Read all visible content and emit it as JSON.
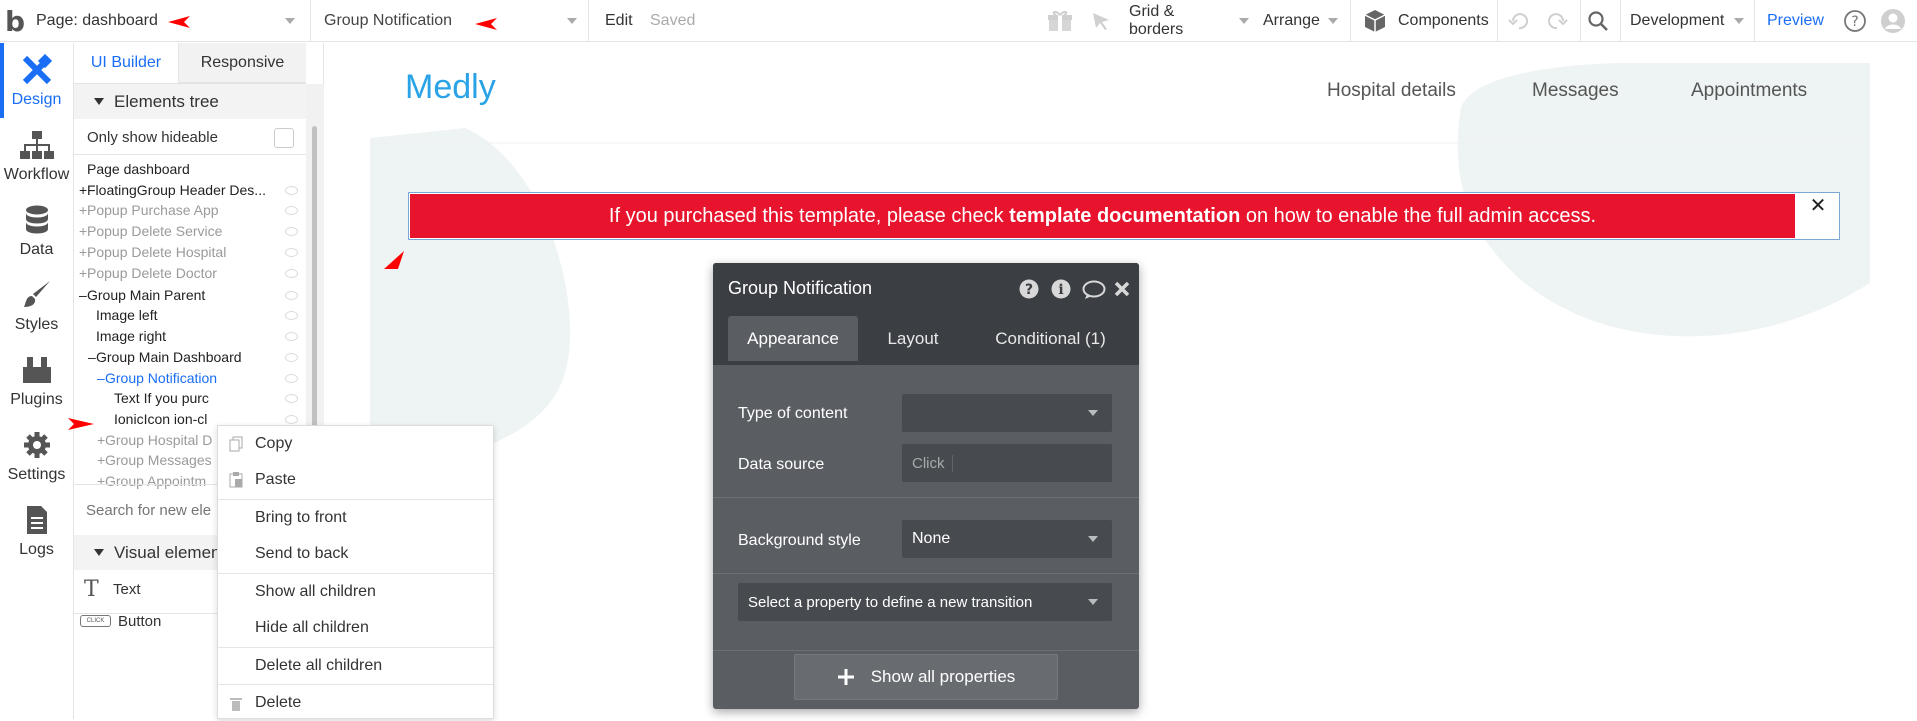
{
  "topbar": {
    "logo": "b",
    "page_selector": "Page: dashboard",
    "element_selector": "Group Notification",
    "edit": "Edit",
    "saved": "Saved",
    "grid_borders": "Grid & borders",
    "arrange": "Arrange",
    "components": "Components",
    "environment": "Development",
    "preview": "Preview",
    "help_icon": "question-circle-icon"
  },
  "rail": {
    "items": [
      {
        "label": "Design",
        "icon": "design-icon",
        "active": true
      },
      {
        "label": "Workflow",
        "icon": "workflow-icon"
      },
      {
        "label": "Data",
        "icon": "database-icon"
      },
      {
        "label": "Styles",
        "icon": "brush-icon"
      },
      {
        "label": "Plugins",
        "icon": "plugins-icon"
      },
      {
        "label": "Settings",
        "icon": "gear-icon"
      },
      {
        "label": "Logs",
        "icon": "document-icon"
      }
    ]
  },
  "panel": {
    "tabs": [
      "UI Builder",
      "Responsive"
    ],
    "elements_tree_label": "Elements tree",
    "only_show_hideable": "Only show hideable",
    "tree": [
      {
        "prefix": "",
        "label": "Page dashboard",
        "state": "normal",
        "indent": 0
      },
      {
        "prefix": "+",
        "label": "FloatingGroup Header Des...",
        "state": "normal",
        "indent": 0
      },
      {
        "prefix": "+",
        "label": "Popup Purchase App",
        "state": "dim",
        "indent": 0
      },
      {
        "prefix": "+",
        "label": "Popup Delete Service",
        "state": "dim",
        "indent": 0
      },
      {
        "prefix": "+",
        "label": "Popup Delete Hospital",
        "state": "dim",
        "indent": 0
      },
      {
        "prefix": "+",
        "label": "Popup Delete Doctor",
        "state": "dim",
        "indent": 0
      },
      {
        "prefix": "–",
        "label": "Group Main Parent",
        "state": "normal",
        "indent": 0
      },
      {
        "prefix": "",
        "label": "Image left",
        "state": "normal",
        "indent": 1
      },
      {
        "prefix": "",
        "label": "Image right",
        "state": "normal",
        "indent": 1
      },
      {
        "prefix": "–",
        "label": "Group Main Dashboard",
        "state": "normal",
        "indent": 1
      },
      {
        "prefix": "–",
        "label": "Group Notification",
        "state": "sel",
        "indent": 2
      },
      {
        "prefix": "",
        "label": "Text If you purc",
        "state": "normal",
        "indent": 3
      },
      {
        "prefix": "",
        "label": "IonicIcon ion-cl",
        "state": "normal",
        "indent": 3
      },
      {
        "prefix": "+",
        "label": "Group Hospital D",
        "state": "dim",
        "indent": 2
      },
      {
        "prefix": "+",
        "label": "Group Messages",
        "state": "dim",
        "indent": 2
      },
      {
        "prefix": "+",
        "label": "Group Appointm",
        "state": "dim",
        "indent": 2
      }
    ],
    "search_placeholder": "Search for new ele",
    "visual_elements_label": "Visual elemen",
    "visual_items": [
      {
        "label": "Text",
        "icon": "text-T-icon"
      },
      {
        "label": "Button",
        "icon": "button-click-icon",
        "icon_text": "CLICK"
      }
    ]
  },
  "context_menu": {
    "items": [
      "Copy",
      "Paste",
      "Bring to front",
      "Send to back",
      "Show all children",
      "Hide all children",
      "Delete all children",
      "Delete"
    ]
  },
  "canvas": {
    "logo": "Medly",
    "nav": [
      "Hospital details",
      "Messages",
      "Appointments"
    ],
    "banner_pre": "If you purchased this template, please check ",
    "banner_bold": "template documentation",
    "banner_post": " on how to enable the full admin access.",
    "banner_close": "✕"
  },
  "property_editor": {
    "title": "Group Notification",
    "tabs": [
      "Appearance",
      "Layout",
      "Conditional (1)"
    ],
    "type_of_content_label": "Type of content",
    "type_of_content_value": "",
    "data_source_label": "Data source",
    "data_source_value": "Click",
    "background_style_label": "Background style",
    "background_style_value": "None",
    "transition_placeholder": "Select a property to define a new transition",
    "show_all_properties": "Show all properties"
  },
  "colors": {
    "accent": "#1a6ef5",
    "banner_red": "#e8132d",
    "brand_blue": "#29a3e6",
    "editor_bg": "#5a5e62",
    "arrow_red": "#ff0000"
  }
}
